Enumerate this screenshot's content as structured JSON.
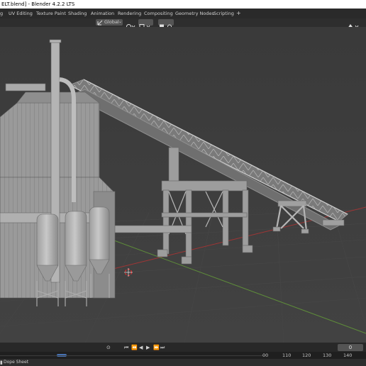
{
  "window": {
    "title": "ELT.blend] - Blender 4.2.2 LTS"
  },
  "workspaces": {
    "tabs": [
      "g",
      "UV Editing",
      "Texture Paint",
      "Shading",
      "Animation",
      "Rendering",
      "Compositing",
      "Geometry Nodes",
      "Scripting"
    ],
    "add_label": "+"
  },
  "viewport_header": {
    "orientation": "Global"
  },
  "timeline": {
    "current_frame": "0",
    "ruler_ticks": [
      "00",
      "110",
      "120",
      "130",
      "140"
    ],
    "editor_label": "Dope Sheet",
    "playhead_frame": 0
  },
  "colors": {
    "accent_blue": "#4772b3",
    "axis_x": "#a03535",
    "axis_y": "#5e8c3a",
    "viewport_bg": "#3d3d3d"
  }
}
